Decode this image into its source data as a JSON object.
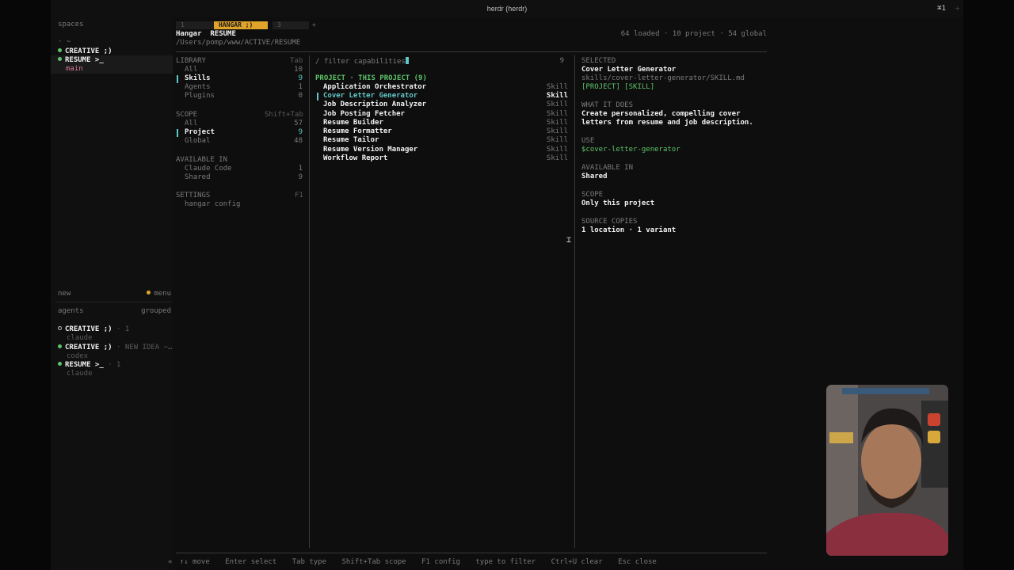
{
  "window": {
    "title": "herdr (herdr)",
    "shortcut": "⌘1",
    "new_tab": "+"
  },
  "sidebar": {
    "spaces_label": "spaces",
    "spaces": [
      {
        "label": "~",
        "marker": "·"
      },
      {
        "label": "CREATIVE ;)",
        "status": "green"
      },
      {
        "label": "RESUME >_",
        "status": "green",
        "selected": true,
        "sub": "main"
      }
    ],
    "new_label": "new",
    "menu_label": "menu",
    "agents_label": "agents",
    "grouped_label": "grouped",
    "agents": [
      {
        "name": "CREATIVE ;)",
        "meta": "· 1",
        "agent": "claude",
        "status": "hollow"
      },
      {
        "name": "CREATIVE ;)",
        "meta": "· NEW IDEA ~…",
        "agent": "codex",
        "status": "green"
      },
      {
        "name": "RESUME >_",
        "meta": "· 1",
        "agent": "claude",
        "status": "green"
      }
    ]
  },
  "tabs": [
    {
      "label": "1"
    },
    {
      "label": "HANGAR ;)",
      "active": true
    },
    {
      "label": "3"
    },
    {
      "label": "+"
    }
  ],
  "header": {
    "app": "Hangar",
    "context": "RESUME",
    "path": "/Users/pomp/www/ACTIVE/RESUME",
    "stats": "64 loaded · 10 project · 54 global"
  },
  "library": {
    "title": "LIBRARY",
    "hint": "Tab",
    "items": [
      {
        "label": "All",
        "count": "10"
      },
      {
        "label": "Skills",
        "count": "9",
        "active": true
      },
      {
        "label": "Agents",
        "count": "1"
      },
      {
        "label": "Plugins",
        "count": "0"
      }
    ]
  },
  "scope": {
    "title": "SCOPE",
    "hint": "Shift+Tab",
    "items": [
      {
        "label": "All",
        "count": "57"
      },
      {
        "label": "Project",
        "count": "9",
        "active": true
      },
      {
        "label": "Global",
        "count": "48"
      }
    ]
  },
  "available": {
    "title": "AVAILABLE IN",
    "items": [
      {
        "label": "Claude Code",
        "count": "1"
      },
      {
        "label": "Shared",
        "count": "9"
      }
    ]
  },
  "settings": {
    "title": "SETTINGS",
    "hint": "F1",
    "items": [
      {
        "label": "hangar config"
      }
    ]
  },
  "list": {
    "filter_placeholder": "/ filter capabilities",
    "count": "9",
    "group_title": "PROJECT · THIS PROJECT (9)",
    "items": [
      {
        "name": "Application Orchestrator",
        "type": "Skill"
      },
      {
        "name": "Cover Letter Generator",
        "type": "Skill",
        "selected": true
      },
      {
        "name": "Job Description Analyzer",
        "type": "Skill"
      },
      {
        "name": "Job Posting Fetcher",
        "type": "Skill"
      },
      {
        "name": "Resume Builder",
        "type": "Skill"
      },
      {
        "name": "Resume Formatter",
        "type": "Skill"
      },
      {
        "name": "Resume Tailor",
        "type": "Skill"
      },
      {
        "name": "Resume Version Manager",
        "type": "Skill"
      },
      {
        "name": "Workflow Report",
        "type": "Skill"
      }
    ]
  },
  "detail": {
    "selected_label": "SELECTED",
    "name": "Cover Letter Generator",
    "path": "skills/cover-letter-generator/SKILL.md",
    "tags": "[PROJECT] [SKILL]",
    "what_label": "WHAT IT DOES",
    "what_line1": "Create personalized, compelling cover",
    "what_line2": "letters from resume and job description.",
    "use_label": "USE",
    "use_value": "$cover-letter-generator",
    "available_label": "AVAILABLE IN",
    "available_value": "Shared",
    "scope_label": "SCOPE",
    "scope_value": "Only this project",
    "source_label": "SOURCE COPIES",
    "source_value": "1 location · 1 variant"
  },
  "footer": {
    "arrow": "«",
    "hints": [
      "↑↓ move",
      "Enter select",
      "Tab type",
      "Shift+Tab scope",
      "F1 config",
      "type to filter",
      "Ctrl+U clear",
      "Esc close"
    ]
  },
  "colors": {
    "accent_cyan": "#62c6c6",
    "accent_green": "#5fc36a",
    "accent_orange": "#e0a42a",
    "background": "#0e0e0e"
  }
}
